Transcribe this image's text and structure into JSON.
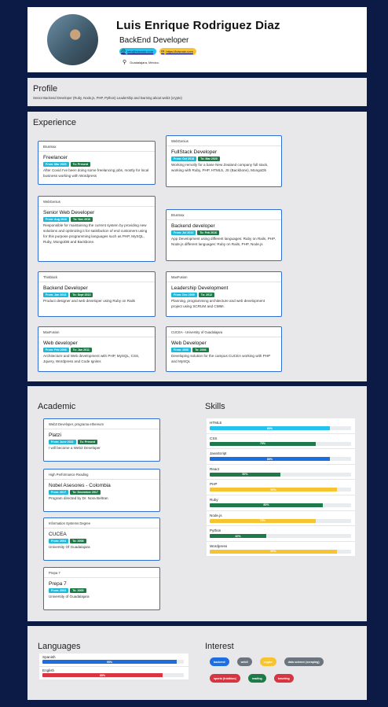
{
  "colors": {
    "page_bg": "#0c1a46",
    "card_border": "#2e6fd1",
    "from_badge": "#1fb8d8",
    "to_badge": "#1f7a4a"
  },
  "header": {
    "name": "Luis Enrique Rodriguez Diaz",
    "role": "BackEnd Developer",
    "email": "info@luisrodz.com",
    "website": "https://luisrodz.com",
    "location": "Guadalajara, México."
  },
  "profile": {
    "title": "Profile",
    "text": "Senior Backend Developer (Ruby, Node.js, PHP, Python) Leadership and learning about web3 (crypto)"
  },
  "experience": {
    "title": "Experience",
    "items": [
      {
        "company": "Brusmax",
        "title": "Freelancer",
        "from": "From: Mar 2020",
        "to": "To: Present",
        "desc": "After Covid I've been doing some freelancing jobs, mostly for local business working with Wordpress"
      },
      {
        "company": "WebGenius",
        "title": "FullStack Developer",
        "from": "From: Oct 2018",
        "to": "To: Mar 2020",
        "desc": "Working remotly for a base New Zealand company full stack, working with Ruby, PHP, HTML5, JS (Backbone), MongoDb"
      },
      {
        "company": "WebGenius",
        "title": "Senior Web Developer",
        "from": "From: Aug 2016",
        "to": "To: Nov 2016",
        "desc": "Responsible for maintaining the current system by providing new solutions and optimizing it for satisfaction of end customers using for this purpose programming languages such as PHP, MySQL, Ruby, MongoDB and Backbone."
      },
      {
        "company": "Brusmax",
        "title": "Backend developer",
        "from": "From: Jul 2013",
        "to": "To: Feb 2016",
        "desc": "App Development using different languages: Ruby on Rails, PHP, Node.js different languages: Ruby on Rails, PHP, Node.js"
      },
      {
        "company": "Thinblack",
        "title": "Backend Developer",
        "from": "From: Jan 2013",
        "to": "To: Sept 2013",
        "desc": "Product designer and web developer using Ruby on Rails"
      },
      {
        "company": "MaxFusion",
        "title": "Leadership Development",
        "from": "From: Dec 2009",
        "to": "To: 2012",
        "desc": "Planning, programming architecture and web development project using SCRUM and CMMI."
      },
      {
        "company": "MaxFusion",
        "title": "Web developer",
        "from": "From: Feb 2008",
        "to": "To: Jan 2011",
        "desc": "Architecture and Web development with PHP, MySQL, CSS, Jquery, Wordpress and Code Igniter."
      },
      {
        "company": "CUCEA - University of Guadalajara",
        "title": "Web Developer",
        "from": "From: 2006",
        "to": "To: 2008",
        "desc": "Developing solution for the campus CUCEA working with PHP and MySQL"
      }
    ]
  },
  "academic": {
    "title": "Academic",
    "items": [
      {
        "header": "Web3 Developer, programa ethereum",
        "title": "Platzi",
        "from": "From: June 2022",
        "to": "To: Present",
        "desc": "I will become a Web3 Developer"
      },
      {
        "header": "High Performance Reading",
        "title": "Nobel Asesores - Colombia",
        "from": "From: 2017",
        "to": "To: December 2017",
        "desc": "Program directed by Dr. Nora Beltran"
      },
      {
        "header": "Information Systems Degree",
        "title": "CUCEA",
        "from": "From: 2004",
        "to": "To: 2008",
        "desc": "University Of Guadalajara"
      },
      {
        "header": "Prepa 7",
        "title": "Prepa 7",
        "from": "From: 2003",
        "to": "To: 2005",
        "desc": "University of Guadalajara"
      }
    ]
  },
  "skills": {
    "title": "Skills",
    "items": [
      {
        "name": "HTML5",
        "percent": 85,
        "label": "85%",
        "color": "#22c4ee"
      },
      {
        "name": "CSS",
        "percent": 75,
        "label": "75%",
        "color": "#1f7a4a"
      },
      {
        "name": "JavaScript",
        "percent": 85,
        "label": "85%",
        "color": "#1d6fe0"
      },
      {
        "name": "React",
        "percent": 50,
        "label": "50%",
        "color": "#1f7a4a"
      },
      {
        "name": "PHP",
        "percent": 90,
        "label": "90%",
        "color": "#f6c431"
      },
      {
        "name": "Ruby",
        "percent": 80,
        "label": "80%",
        "color": "#1f7a4a"
      },
      {
        "name": "Node.js",
        "percent": 75,
        "label": "75%",
        "color": "#f6c431"
      },
      {
        "name": "Python",
        "percent": 40,
        "label": "40%",
        "color": "#1f7a4a"
      },
      {
        "name": "Wordpress",
        "percent": 90,
        "label": "90%",
        "color": "#f6c431"
      }
    ]
  },
  "languages": {
    "title": "Languages",
    "items": [
      {
        "name": "Spanish",
        "percent": 95,
        "label": "95%",
        "color": "#1d6fe0"
      },
      {
        "name": "English",
        "percent": 85,
        "label": "85%",
        "color": "#d9343f"
      }
    ]
  },
  "interest": {
    "title": "Interest",
    "items": [
      {
        "label": "backend",
        "color": "#1d6fe0"
      },
      {
        "label": "web3",
        "color": "#6c757d"
      },
      {
        "label": "crypto",
        "color": "#f6c431"
      },
      {
        "label": "data science (scraping)",
        "color": "#6c757d"
      },
      {
        "label": "sports (triathlon)",
        "color": "#d9343f"
      },
      {
        "label": "reading",
        "color": "#1f7a4a"
      },
      {
        "label": "traveling",
        "color": "#d9343f"
      }
    ]
  }
}
